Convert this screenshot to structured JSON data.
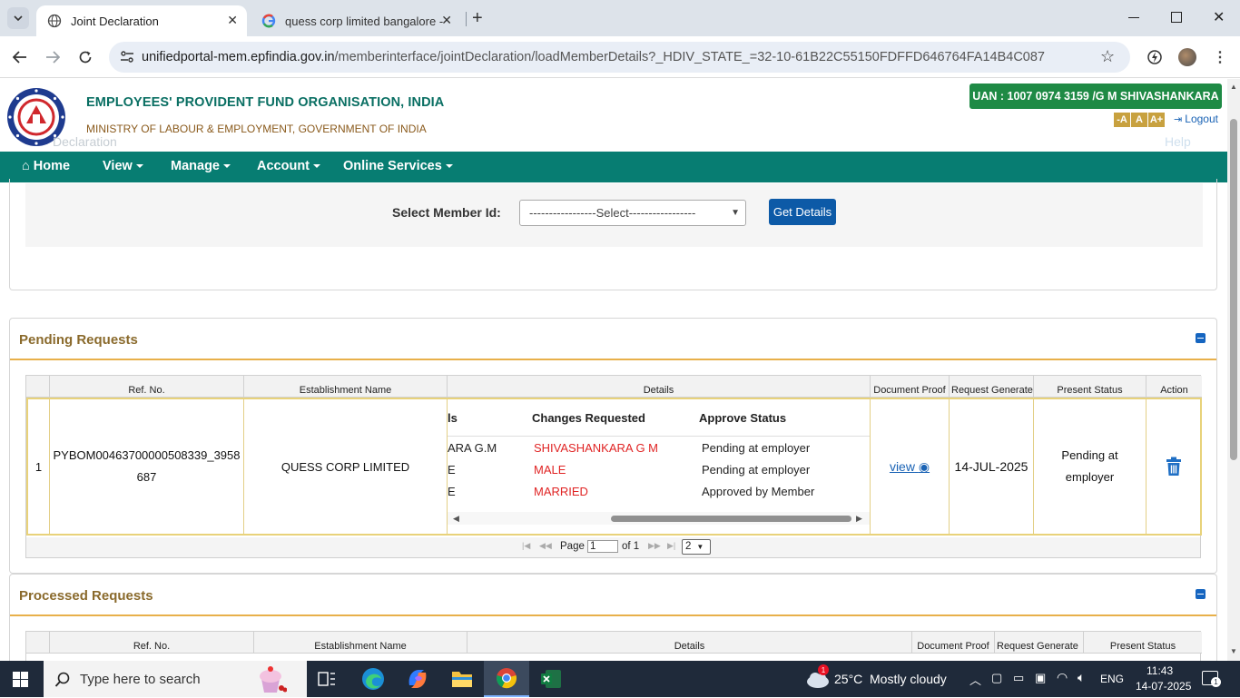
{
  "browser": {
    "tabs": [
      {
        "title": "Joint Declaration",
        "active": true
      },
      {
        "title": "quess corp limited bangalore - ",
        "active": false
      }
    ],
    "url_host": "unifiedportal-mem.epfindia.gov.in",
    "url_path": "/memberinterface/jointDeclaration/loadMemberDetails?_HDIV_STATE_=32-10-61B22C55150FDFFD646764FA14B4C087"
  },
  "header": {
    "org_title": "EMPLOYEES' PROVIDENT FUND ORGANISATION, INDIA",
    "ministry": "MINISTRY OF LABOUR & EMPLOYMENT, GOVERNMENT OF INDIA",
    "uan": "UAN : 1007 0974 3159 /G M SHIVASHANKARA",
    "font_small": "-A",
    "font_normal": "A",
    "font_large": "A+",
    "logout": "Logout",
    "ghost_title": "Declaration",
    "ghost_help": "Help"
  },
  "nav": {
    "home": "Home",
    "view": "View",
    "manage": "Manage",
    "account": "Account",
    "online_services": "Online Services"
  },
  "select_member": {
    "label": "Select Member Id:",
    "selected": "-----------------Select-----------------",
    "button": "Get Details"
  },
  "pending": {
    "title": "Pending Requests",
    "columns": [
      "Ref. No.",
      "Establishment Name",
      "Details",
      "Document Proof",
      "Request Generate",
      "Present Status",
      "Action"
    ],
    "row": {
      "index": "1",
      "ref_no": "PYBOM00463700000508339_3958687",
      "establishment": "QUESS CORP LIMITED",
      "details_header_partial": "ls",
      "details_changes_header": "Changes Requested",
      "details_status_header": "Approve Status",
      "details_rows": [
        {
          "partial": "ARA G.M",
          "change": "SHIVASHANKARA G M",
          "status": "Pending at employer"
        },
        {
          "partial": "E",
          "change": "MALE",
          "status": "Pending at employer"
        },
        {
          "partial": "E",
          "change": "MARRIED",
          "status": "Approved by Member"
        }
      ],
      "doc_proof": "view",
      "request_date": "14-JUL-2025",
      "present_status": "Pending at employer"
    },
    "pager": {
      "page_label": "Page",
      "page_value": "1",
      "of_label": "of 1",
      "page_size": "2"
    }
  },
  "processed": {
    "title": "Processed Requests",
    "columns": [
      "Ref. No.",
      "Establishment Name",
      "Details",
      "Document Proof",
      "Request Generate",
      "Present Status"
    ]
  },
  "taskbar": {
    "search_placeholder": "Type here to search",
    "weather_temp": "25°C",
    "weather_desc": "Mostly cloudy",
    "lang": "ENG",
    "time": "11:43",
    "date": "14-07-2025",
    "notif_count": "1"
  }
}
